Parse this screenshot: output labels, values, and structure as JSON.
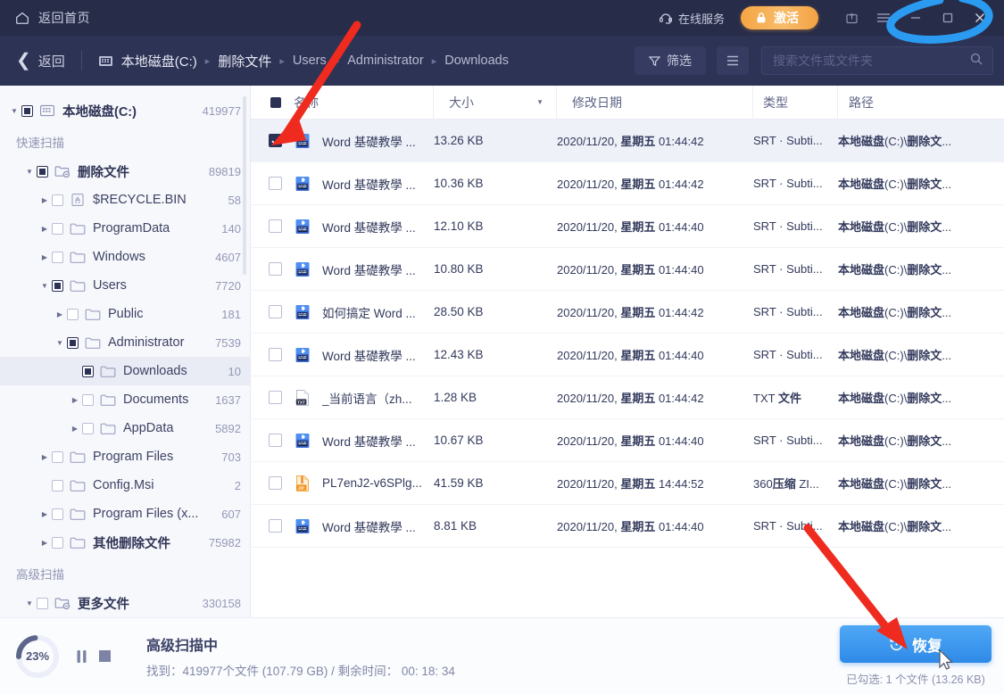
{
  "titlebar": {
    "home_label": "返回首页",
    "home_icon": "home-icon",
    "service_label": "在线服务",
    "service_icon": "headset-icon",
    "activate_label": "激活",
    "activate_icon": "lock-icon",
    "activate_color": "#f3a143",
    "bg_color": "#272c48",
    "window_buttons": [
      "share-icon",
      "menu-icon",
      "minimize-icon",
      "maximize-icon",
      "close-icon"
    ]
  },
  "navbar": {
    "back_label": "返回",
    "drive_icon": "hard-drive-icon",
    "breadcrumbs": [
      "本地磁盘(C:)",
      "删除文件",
      "Users",
      "Administrator",
      "Downloads"
    ],
    "separator": "▸",
    "filter_label": "筛选",
    "filter_icon": "funnel-icon",
    "list_icon": "list-view-icon",
    "search_placeholder": "搜索文件或文件夹",
    "search_value": "",
    "search_icon": "search-icon",
    "bg_color": "#2d3355"
  },
  "sidebar": {
    "items": [
      {
        "label": "本地磁盘(C:)",
        "count": "419977",
        "depth": 0,
        "arrow": "down",
        "check": "partial",
        "icon": "drive-icon",
        "cn": true,
        "selected": false
      },
      {
        "label": "快速扫描",
        "group": true
      },
      {
        "label": "删除文件",
        "count": "89819",
        "depth": 1,
        "arrow": "down",
        "check": "partial",
        "icon": "deleted-folder-icon",
        "cn": true,
        "selected": false
      },
      {
        "label": "$RECYCLE.BIN",
        "count": "58",
        "depth": 2,
        "arrow": "right",
        "check": "none",
        "icon": "recycle-icon",
        "cn": false,
        "selected": false
      },
      {
        "label": "ProgramData",
        "count": "140",
        "depth": 2,
        "arrow": "right",
        "check": "none",
        "icon": "folder-icon",
        "cn": false,
        "selected": false
      },
      {
        "label": "Windows",
        "count": "4607",
        "depth": 2,
        "arrow": "right",
        "check": "none",
        "icon": "folder-icon",
        "cn": false,
        "selected": false
      },
      {
        "label": "Users",
        "count": "7720",
        "depth": 2,
        "arrow": "down",
        "check": "partial",
        "icon": "folder-icon",
        "cn": false,
        "selected": false
      },
      {
        "label": "Public",
        "count": "181",
        "depth": 3,
        "arrow": "right",
        "check": "none",
        "icon": "folder-icon",
        "cn": false,
        "selected": false
      },
      {
        "label": "Administrator",
        "count": "7539",
        "depth": 3,
        "arrow": "down",
        "check": "partial",
        "icon": "folder-icon",
        "cn": false,
        "selected": false
      },
      {
        "label": "Downloads",
        "count": "10",
        "depth": 4,
        "arrow": "none",
        "check": "partial",
        "icon": "folder-icon",
        "cn": false,
        "selected": true
      },
      {
        "label": "Documents",
        "count": "1637",
        "depth": 4,
        "arrow": "right",
        "check": "none",
        "icon": "folder-icon",
        "cn": false,
        "selected": false
      },
      {
        "label": "AppData",
        "count": "5892",
        "depth": 4,
        "arrow": "right",
        "check": "none",
        "icon": "folder-icon",
        "cn": false,
        "selected": false
      },
      {
        "label": "Program Files",
        "count": "703",
        "depth": 2,
        "arrow": "right",
        "check": "none",
        "icon": "folder-icon",
        "cn": false,
        "selected": false
      },
      {
        "label": "Config.Msi",
        "count": "2",
        "depth": 2,
        "arrow": "none",
        "check": "none",
        "icon": "folder-icon",
        "cn": false,
        "selected": false
      },
      {
        "label": "Program Files (x...",
        "count": "607",
        "depth": 2,
        "arrow": "right",
        "check": "none",
        "icon": "folder-icon",
        "cn": false,
        "selected": false
      },
      {
        "label": "其他删除文件",
        "count": "75982",
        "depth": 2,
        "arrow": "right",
        "check": "none",
        "icon": "folder-icon",
        "cn": true,
        "selected": false
      },
      {
        "label": "高级扫描",
        "group": true
      },
      {
        "label": "更多文件",
        "count": "330158",
        "depth": 1,
        "arrow": "down",
        "check": "none",
        "icon": "more-files-icon",
        "cn": true,
        "selected": false
      }
    ]
  },
  "filetable": {
    "columns": [
      {
        "key": "name",
        "label": "名称"
      },
      {
        "key": "size",
        "label": "大小"
      },
      {
        "key": "date",
        "label": "修改日期"
      },
      {
        "key": "type",
        "label": "类型"
      },
      {
        "key": "path",
        "label": "路径"
      }
    ],
    "sort_column": "大小",
    "sort_caret": "▼",
    "rows": [
      {
        "checked": true,
        "icon": "srt-file-icon",
        "name": "Word 基礎教學 ...",
        "size": "13.26 KB",
        "date": "2020/11/20, 星期五 01:44:42",
        "type": "SRT · Subti...",
        "path": "本地磁盘(C:)\\删除文..."
      },
      {
        "checked": false,
        "icon": "srt-file-icon",
        "name": "Word 基礎教學 ...",
        "size": "10.36 KB",
        "date": "2020/11/20, 星期五 01:44:42",
        "type": "SRT · Subti...",
        "path": "本地磁盘(C:)\\删除文..."
      },
      {
        "checked": false,
        "icon": "srt-file-icon",
        "name": "Word 基礎教學 ...",
        "size": "12.10 KB",
        "date": "2020/11/20, 星期五 01:44:40",
        "type": "SRT · Subti...",
        "path": "本地磁盘(C:)\\删除文..."
      },
      {
        "checked": false,
        "icon": "srt-file-icon",
        "name": "Word 基礎教學 ...",
        "size": "10.80 KB",
        "date": "2020/11/20, 星期五 01:44:40",
        "type": "SRT · Subti...",
        "path": "本地磁盘(C:)\\删除文..."
      },
      {
        "checked": false,
        "icon": "srt-file-icon",
        "name": "如何搞定 Word ...",
        "size": "28.50 KB",
        "date": "2020/11/20, 星期五 01:44:42",
        "type": "SRT · Subti...",
        "path": "本地磁盘(C:)\\删除文..."
      },
      {
        "checked": false,
        "icon": "srt-file-icon",
        "name": "Word 基礎教學 ...",
        "size": "12.43 KB",
        "date": "2020/11/20, 星期五 01:44:40",
        "type": "SRT · Subti...",
        "path": "本地磁盘(C:)\\删除文..."
      },
      {
        "checked": false,
        "icon": "txt-file-icon",
        "name": "_当前语言（zh...",
        "size": "1.28 KB",
        "date": "2020/11/20, 星期五 01:44:42",
        "type": "TXT 文件",
        "path": "本地磁盘(C:)\\删除文..."
      },
      {
        "checked": false,
        "icon": "srt-file-icon",
        "name": "Word 基礎教學 ...",
        "size": "10.67 KB",
        "date": "2020/11/20, 星期五 01:44:40",
        "type": "SRT · Subti...",
        "path": "本地磁盘(C:)\\删除文..."
      },
      {
        "checked": false,
        "icon": "zip-file-icon",
        "name": "PL7enJ2-v6SPlg...",
        "size": "41.59 KB",
        "date": "2020/11/20, 星期五 14:44:52",
        "type": "360压缩 ZI...",
        "path": "本地磁盘(C:)\\删除文..."
      },
      {
        "checked": false,
        "icon": "srt-file-icon",
        "name": "Word 基礎教學 ...",
        "size": "8.81 KB",
        "date": "2020/11/20, 星期五 01:44:40",
        "type": "SRT · Subti...",
        "path": "本地磁盘(C:)\\删除文..."
      }
    ]
  },
  "bottom": {
    "progress_percent": "23%",
    "progress_value": 23,
    "pause_icon": "pause-icon",
    "stop_icon": "stop-icon",
    "scan_title": "高级扫描中",
    "scan_detail": "找到：419977个文件 (107.79 GB) / 剩余时间： 00: 18: 34",
    "recover_label": "恢复",
    "recover_icon": "restore-icon",
    "recover_color": "#2f8ae8",
    "selected_summary": "已勾选: 1 个文件 (13.26 KB)"
  },
  "annotations": {
    "arrow_color": "#ee2b1e",
    "circle_color": "#2a9bf0",
    "items": [
      "arrow-to-row-checkbox",
      "arrow-to-recover-button",
      "circle-on-window-controls"
    ]
  }
}
